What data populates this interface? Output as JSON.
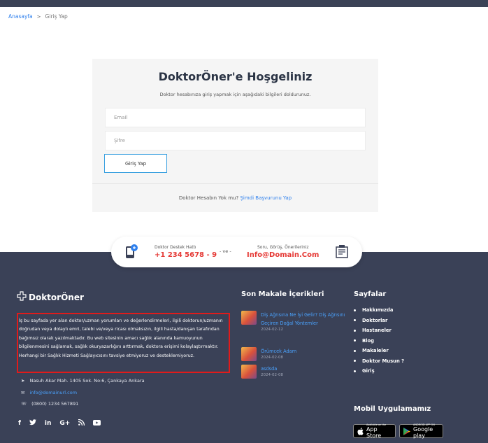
{
  "breadcrumb": {
    "home": "Anasayfa",
    "separator": ">",
    "current": "Giriş Yap"
  },
  "login": {
    "title": "DoktorÖner'e Hoşgeliniz",
    "subtitle": "Doktor hesabınıza giriş yapmak için aşağıdaki bilgileri doldurunuz.",
    "email_placeholder": "Email",
    "password_placeholder": "Şifre",
    "submit_label": "Giriş Yap",
    "register_text": "Doktor Hesabın Yok mu?",
    "register_link": "Şimdi Başvurunu Yap"
  },
  "contact": {
    "hotline_label": "Doktor Destek Hattı",
    "hotline_value": "+1 234 5678 - 9",
    "separator": "- ve -",
    "mail_label": "Soru, Görüş, Önerileriniz",
    "mail_value": "Info@Domain.Com"
  },
  "footer": {
    "logo_text": "DoktorÖner",
    "disclaimer": "İş bu sayfada yer alan doktor/uzman yorumları ve değerlendirmeleri, ilgili doktorun/uzmanın doğrudan veya dolaylı emri, talebi ve/veya ricası olmaksızın, ilgili hasta/danışan tarafından bağımsız olarak yazılmaktadır. Bu web sitesinin amacı sağlık alanında kamuoyunun bilgilenmesini sağlamak, sağlık okuryazarlığını arttırmak, doktora erişimi kolaylaştırmaktır. Herhangi bir Sağlık Hizmeti Sağlayıcısını tavsiye etmiyoruz ve desteklemiyoruz.",
    "address": "Nasuh Akar Mah. 1405 Sok. No:6, Çankaya Ankara",
    "email": "info@domainurl.com",
    "phone": "(0800) 1234 567891",
    "social_icons": [
      "facebook-icon",
      "twitter-icon",
      "linkedin-icon",
      "google-plus-icon",
      "rss-icon",
      "youtube-icon"
    ],
    "articles_title": "Son Makale İçerikleri",
    "articles": [
      {
        "title": "Diş Ağrısına Ne İyi Gelir? Diş Ağrısını Geçiren Doğal Yöntemler",
        "date": "2024-02-12"
      },
      {
        "title": "Örümcek Adam",
        "date": "2024-02-08"
      },
      {
        "title": "asdsda",
        "date": "2024-02-08"
      }
    ],
    "pages_title": "Sayfalar",
    "pages": [
      "Hakkımızda",
      "Doktorlar",
      "Hastaneler",
      "Blog",
      "Makaleler",
      "Doktor Musun ?",
      "Giriş"
    ],
    "mobile_title": "Mobil Uygulamamız",
    "appstore_small": "Available on the",
    "appstore_big": "App Store",
    "googleplay_small": "ANDROID APP ON",
    "googleplay_big": "Google play"
  },
  "colors": {
    "accent": "#2f80ed",
    "footer_bg": "#3a4157",
    "phone_red": "#e53935",
    "highlight_border": "#e01b1b"
  }
}
